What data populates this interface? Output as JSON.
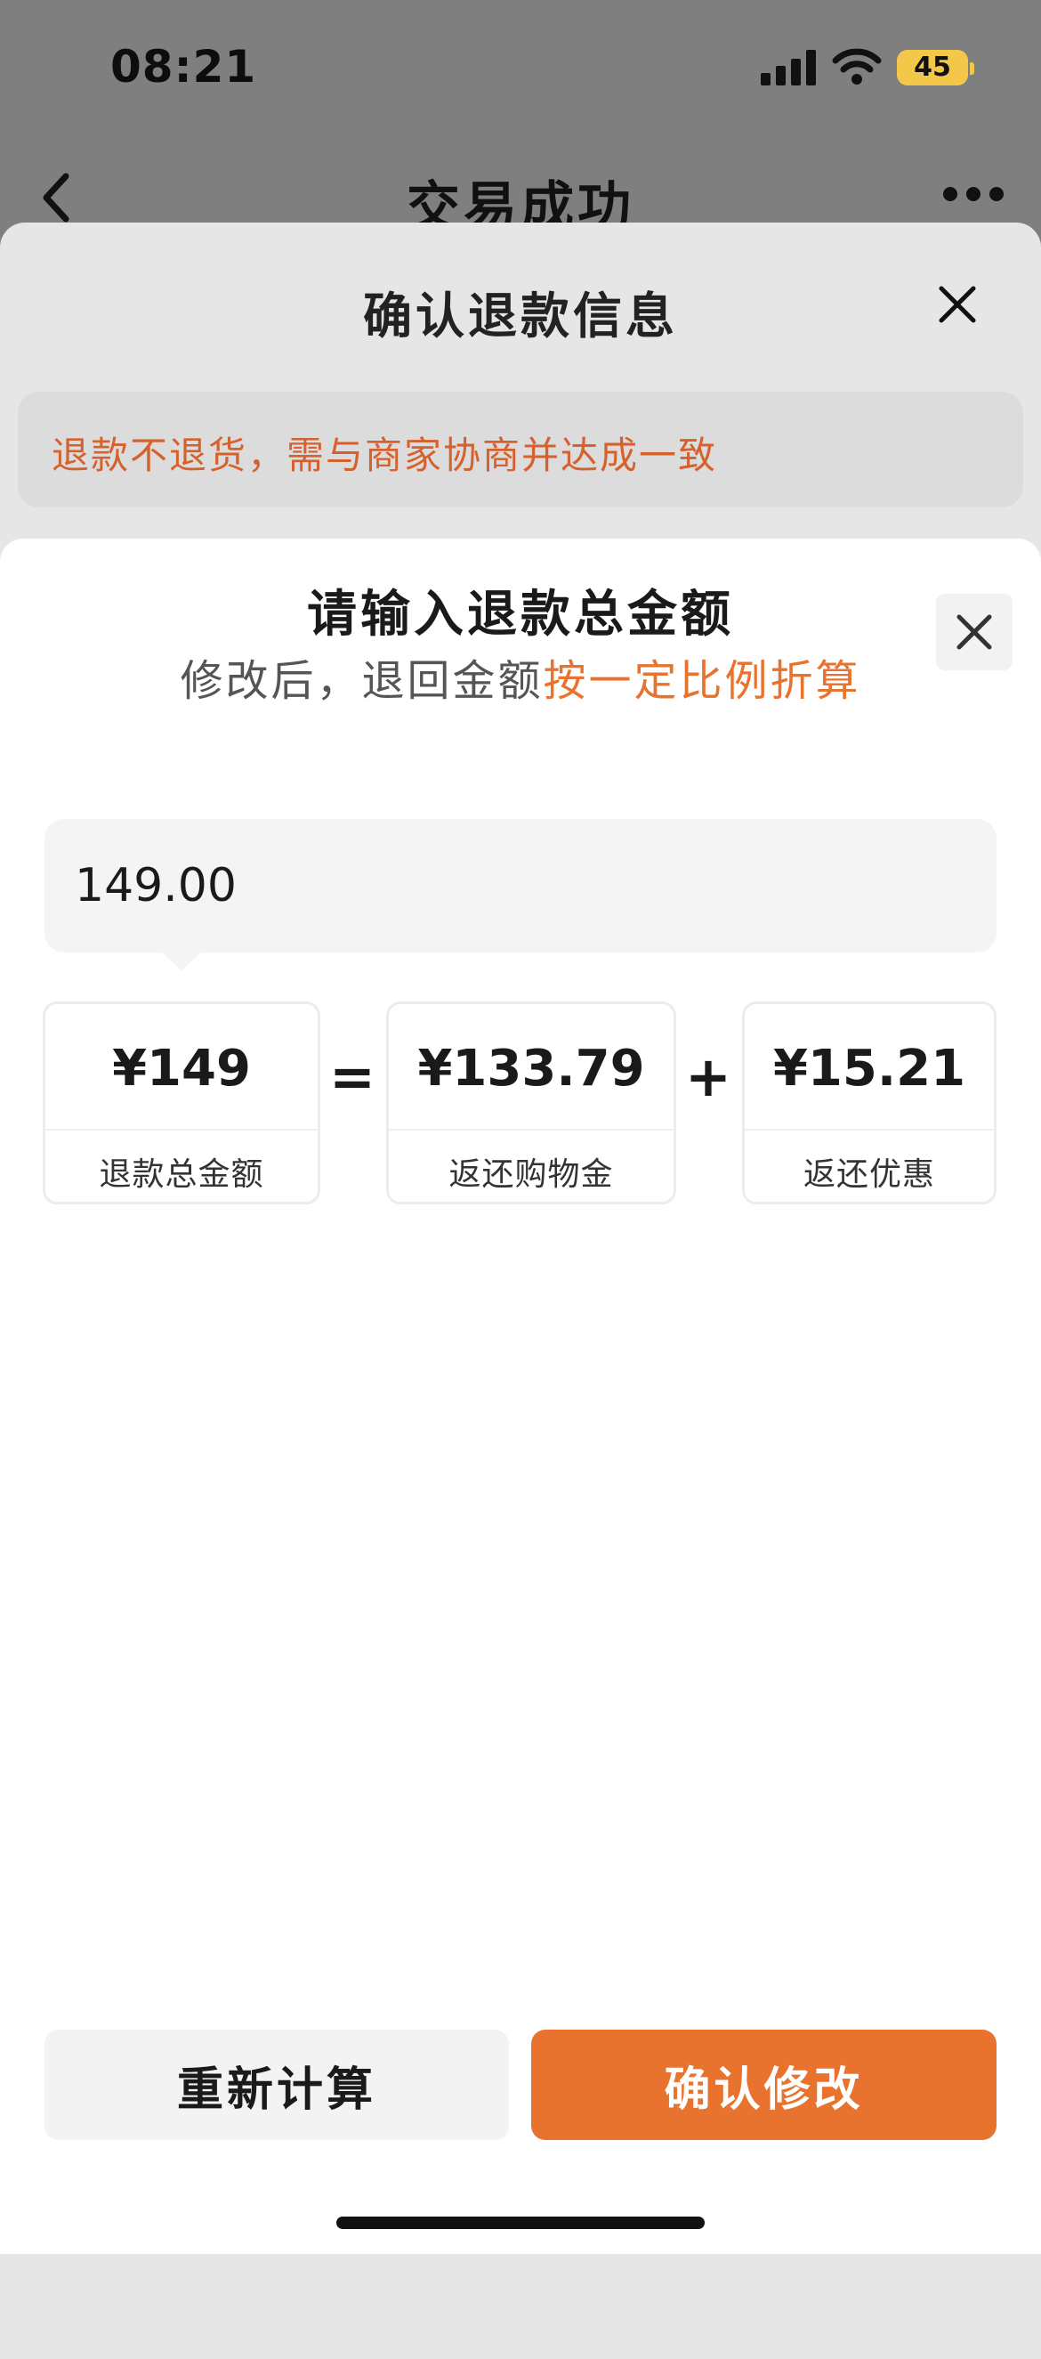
{
  "status_bar": {
    "time": "08:21",
    "battery": "45"
  },
  "nav": {
    "title": "交易成功"
  },
  "refund_sheet": {
    "title": "确认退款信息",
    "notice": "退款不退货，需与商家协商并达成一致"
  },
  "amount_sheet": {
    "title": "请输入退款总金额",
    "subtitle_prefix": "修改后，退回金额",
    "subtitle_highlight": "按一定比例折算",
    "input_value": "149.00",
    "breakdown": [
      {
        "value": "¥149",
        "label": "退款总金额"
      },
      {
        "value": "¥133.79",
        "label": "返还购物金"
      },
      {
        "value": "¥15.21",
        "label": "返还优惠"
      }
    ],
    "operators": [
      "=",
      "+"
    ]
  },
  "actions": {
    "recalc_label": "重新计算",
    "confirm_label": "确认修改"
  },
  "colors": {
    "accent": "#e8732e",
    "notice_text": "#d5622e",
    "battery": "#f3c74a"
  },
  "icons": [
    "back-icon",
    "more-icon",
    "close-icon",
    "signal-icon",
    "wifi-icon",
    "battery-icon"
  ]
}
